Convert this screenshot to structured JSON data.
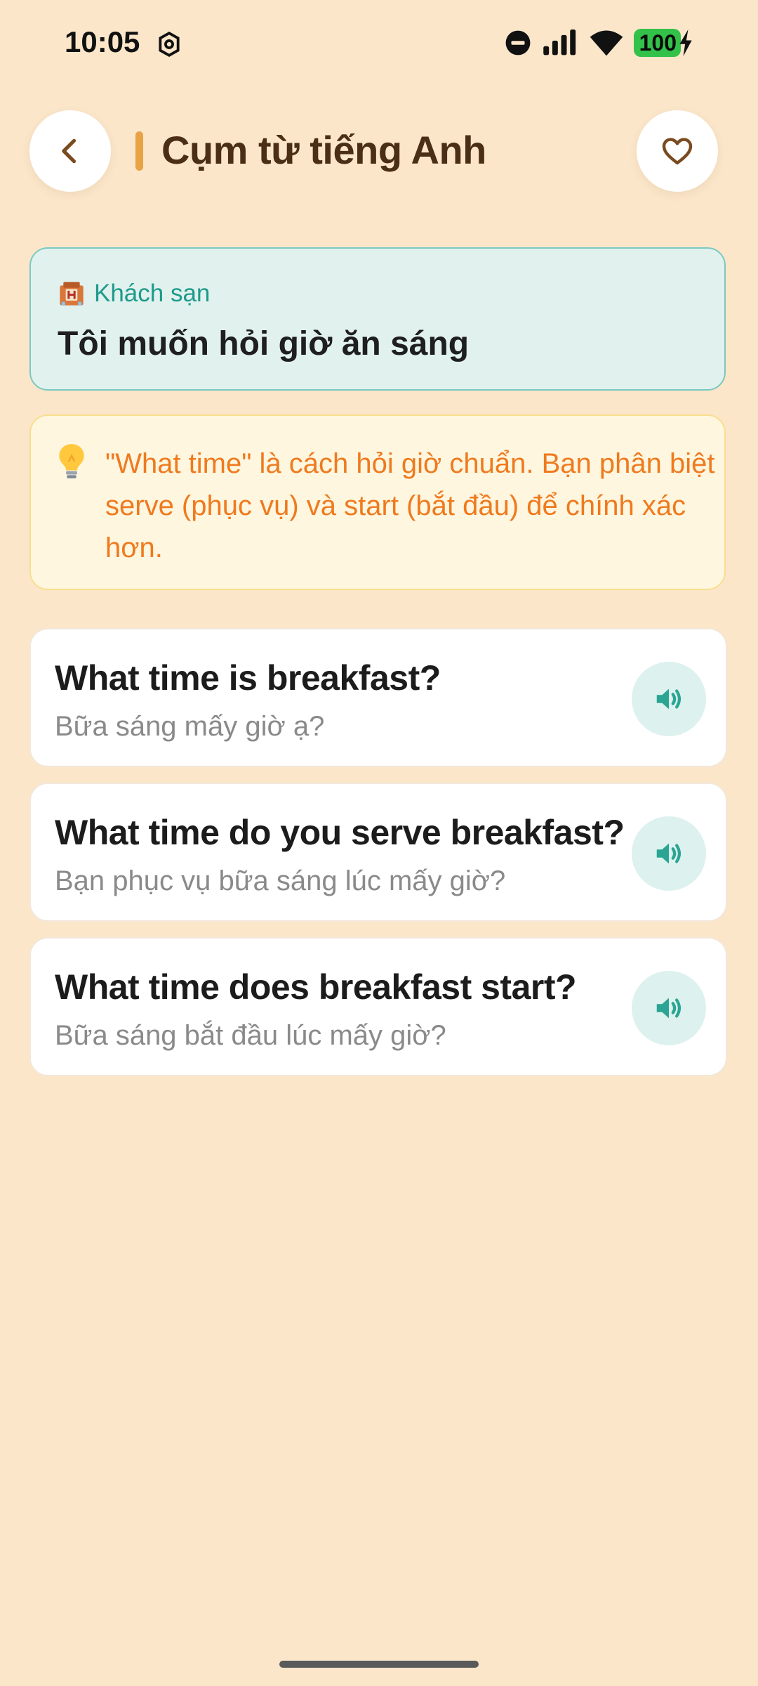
{
  "status_bar": {
    "time": "10:05",
    "battery": "100"
  },
  "header": {
    "title": "Cụm từ tiếng Anh"
  },
  "context": {
    "category": "Khách sạn",
    "text": "Tôi muốn hỏi giờ ăn sáng"
  },
  "tip": {
    "text": "\"What time\" là cách hỏi giờ chuẩn. Bạn phân biệt serve (phục vụ) và start (bắt đầu) để chính xác hơn."
  },
  "phrases": [
    {
      "en": "What time is breakfast?",
      "vi": "Bữa sáng mấy giờ ạ?"
    },
    {
      "en": "What time do you serve breakfast?",
      "vi": "Bạn phục vụ bữa sáng lúc mấy giờ?"
    },
    {
      "en": "What time does breakfast start?",
      "vi": "Bữa sáng bắt đầu lúc mấy giờ?"
    }
  ],
  "colors": {
    "background": "#FBE6CA",
    "accent_teal": "#1E9A8B",
    "accent_orange": "#EF7A1E",
    "title_brown": "#4A2E16"
  },
  "icons": {
    "back": "chevron-left-icon",
    "favorite": "heart-icon",
    "context": "hotel-icon",
    "tip": "lightbulb-icon",
    "speak": "speaker-icon"
  }
}
